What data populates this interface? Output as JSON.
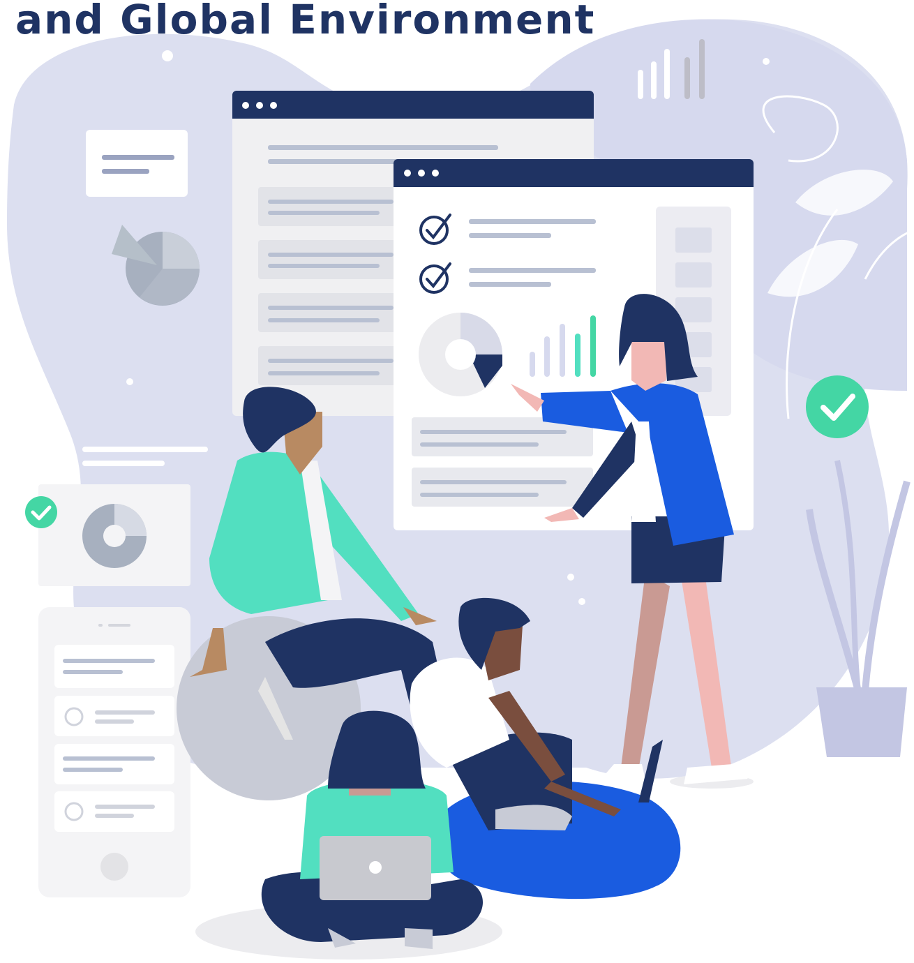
{
  "header": {
    "title": "and Global Environment"
  },
  "colors": {
    "navy": "#1f3363",
    "blob": "#d9dcef",
    "mint": "#52dfc0",
    "blue": "#1a5ce0",
    "check_green": "#44d6a4"
  },
  "icons": [
    "window-dots-icon",
    "check-circle-icon",
    "pie-chart-icon",
    "bar-chart-icon",
    "laptop-apple-icon",
    "plant-leaf-icon"
  ]
}
